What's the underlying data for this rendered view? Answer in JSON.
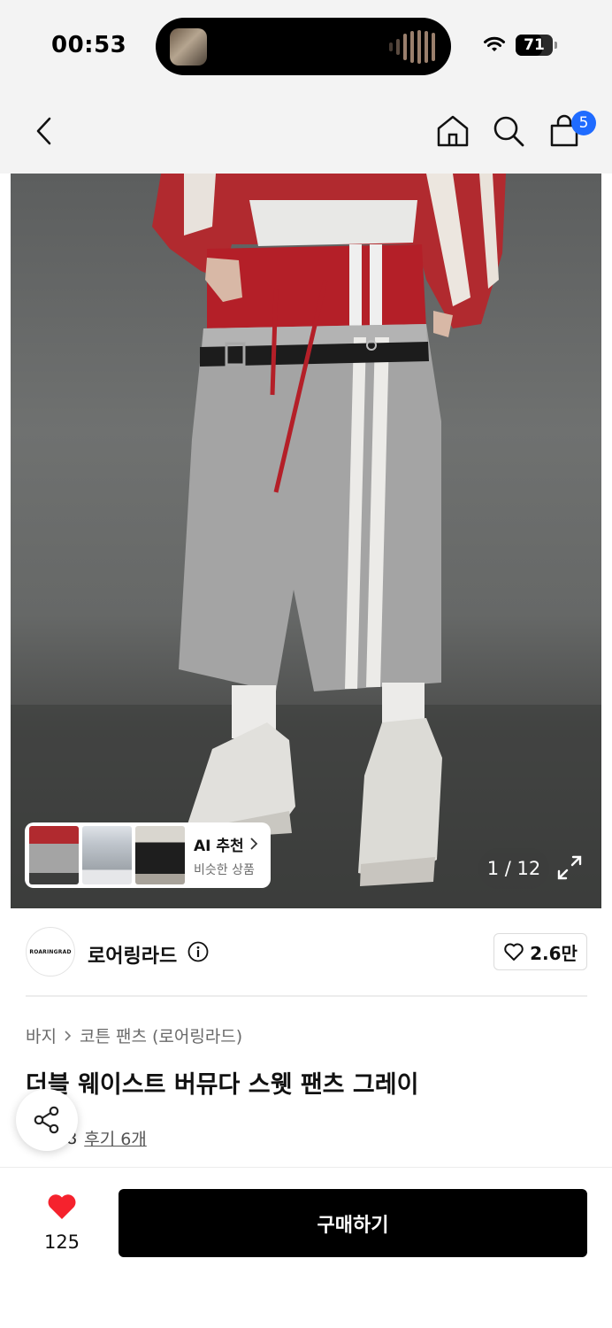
{
  "status_bar": {
    "time": "00:53",
    "battery": "71",
    "battery_level_pct": 71
  },
  "nav": {
    "cart_count": "5",
    "icons": [
      "back-icon",
      "home-icon",
      "search-icon",
      "shopping-bag-icon"
    ]
  },
  "gallery": {
    "counter": "1 / 12",
    "ai_card": {
      "title": "AI 추천",
      "subtitle": "비슷한 상품"
    }
  },
  "brand": {
    "logo_text": "ROARINGRAD",
    "name": "로어링라드",
    "likes": "2.6만"
  },
  "product": {
    "breadcrumb": [
      "바지",
      "코튼 팬츠 (로어링라드)"
    ],
    "title": "더블 웨이스트 버뮤다 스웻 팬츠 그레이",
    "rating": "4.8",
    "reviews": "후기 6개"
  },
  "bottom_bar": {
    "heart_count": "125",
    "buy_label": "구매하기"
  },
  "colors": {
    "accent_blue": "#1f6bff",
    "heart_red": "#f5222d",
    "buy_bg": "#000000"
  }
}
